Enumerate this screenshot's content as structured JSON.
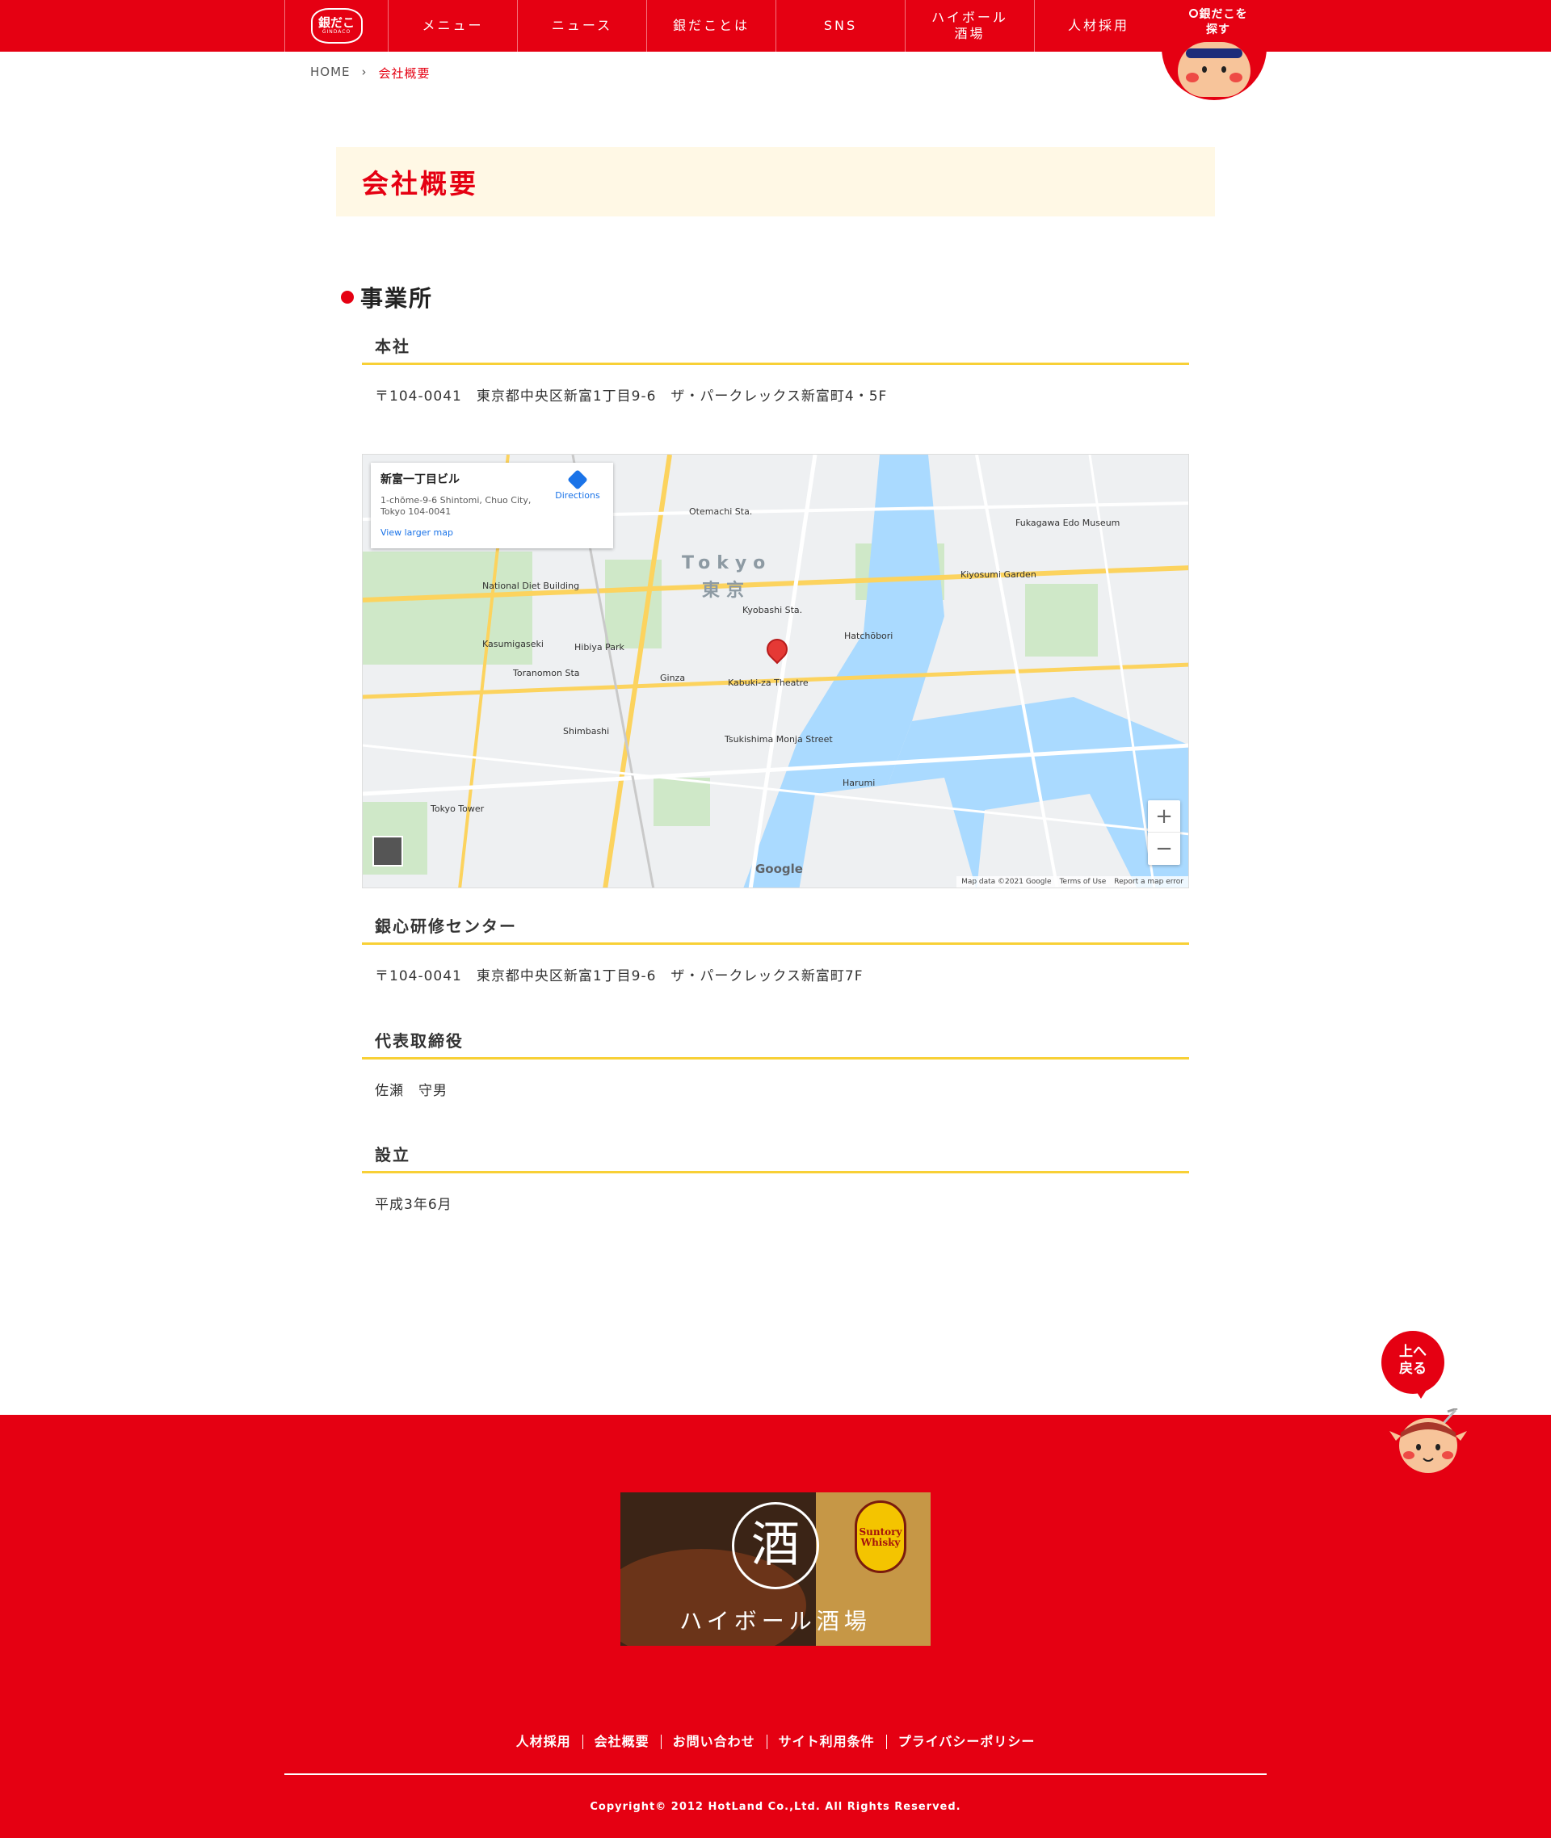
{
  "header": {
    "logo_main": "銀だこ",
    "logo_sub": "GINDACO",
    "nav": [
      {
        "label": "メニュー"
      },
      {
        "label": "ニュース"
      },
      {
        "label": "銀だことは"
      },
      {
        "label": "SNS"
      },
      {
        "label": "ハイボール\n酒場"
      },
      {
        "label": "人材採用"
      }
    ],
    "search_label": "銀だこを\n探す"
  },
  "breadcrumb": {
    "home": "HOME",
    "separator": "›",
    "current": "会社概要"
  },
  "page_title": "会社概要",
  "section_title": "事業所",
  "hq": {
    "label": "本社",
    "address": "〒104-0041　東京都中央区新富1丁目9-6　ザ・パークレックス新富町4・5F"
  },
  "map": {
    "place_name": "新富一丁目ビル",
    "place_address": "1-chōme-9-6 Shintomi, Chuo City, Tokyo 104-0041",
    "directions": "Directions",
    "larger_map": "View larger map",
    "zoom_in": "+",
    "zoom_out": "−",
    "google": "Google",
    "footer_data": "Map data ©2021 Google",
    "footer_terms": "Terms of Use",
    "footer_report": "Report a map error",
    "labels": {
      "tokyo_en": "Tokyo",
      "tokyo_ja": "東京",
      "hibiya": "Hibiya Park",
      "ginza": "Ginza",
      "kabukiza": "Kabuki-za Theatre",
      "tsukishima": "Tsukishima Monja Street",
      "kiyosumi": "Kiyosumi Garden",
      "tokyo_tower": "Tokyo Tower",
      "shimbashi": "Shimbashi",
      "hatchobori": "Hatchōbori",
      "kyobashi": "Kyobashi Sta.",
      "otemachi": "Otemachi Sta.",
      "national_diet": "National Diet Building",
      "kasumigaseki": "Kasumigaseki",
      "toranomon": "Toranomon Sta",
      "fukagawa": "Fukagawa Edo Museum",
      "harumi": "Harumi"
    }
  },
  "training": {
    "label": "銀心研修センター",
    "address": "〒104-0041　東京都中央区新富1丁目9-6　ザ・パークレックス新富町7F"
  },
  "ceo": {
    "label": "代表取締役",
    "value": "佐瀬　守男"
  },
  "founded": {
    "label": "設立",
    "value": "平成3年6月"
  },
  "to_top": "上へ\n戻る",
  "footer": {
    "banner_caption": "ハイボール酒場",
    "banner_seal": "酒",
    "banner_whisky": "Suntory Whisky",
    "links": [
      "人材採用",
      "会社概要",
      "お問い合わせ",
      "サイト利用条件",
      "プライバシーポリシー"
    ],
    "copyright": "Copyright© 2012 HotLand Co.,Ltd. All Rights Reserved."
  },
  "colors": {
    "brand_red": "#e50012",
    "title_bg": "#fff8e5",
    "rule_yellow": "#f8d036"
  }
}
